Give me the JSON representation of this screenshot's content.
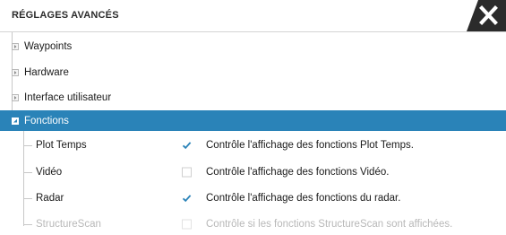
{
  "dialog": {
    "title": "RÉGLAGES AVANCÉS"
  },
  "tree": {
    "items": [
      {
        "label": "Waypoints",
        "expanded": false
      },
      {
        "label": "Hardware",
        "expanded": false
      },
      {
        "label": "Interface utilisateur",
        "expanded": false
      },
      {
        "label": "Fonctions",
        "expanded": true,
        "selected": true
      }
    ],
    "features": [
      {
        "label": "Plot Temps",
        "checked": true,
        "description": "Contrôle l'affichage des fonctions Plot Temps."
      },
      {
        "label": "Vidéo",
        "checked": false,
        "description": "Contrôle l'affichage des fonctions Vidéo."
      },
      {
        "label": "Radar",
        "checked": true,
        "description": "Contrôle l'affichage des fonctions du radar."
      },
      {
        "label": "StructureScan",
        "checked": false,
        "description": "Contrôle si les fonctions StructureScan sont affichées."
      }
    ]
  },
  "colors": {
    "selection": "#2a83b8",
    "check": "#2a83b8",
    "close_bg": "#2b2b2b"
  },
  "icons": {
    "close": "close-icon",
    "collapsed": "expand-arrow-icon",
    "expanded": "collapse-arrow-icon",
    "checkmark": "checkmark-icon"
  }
}
